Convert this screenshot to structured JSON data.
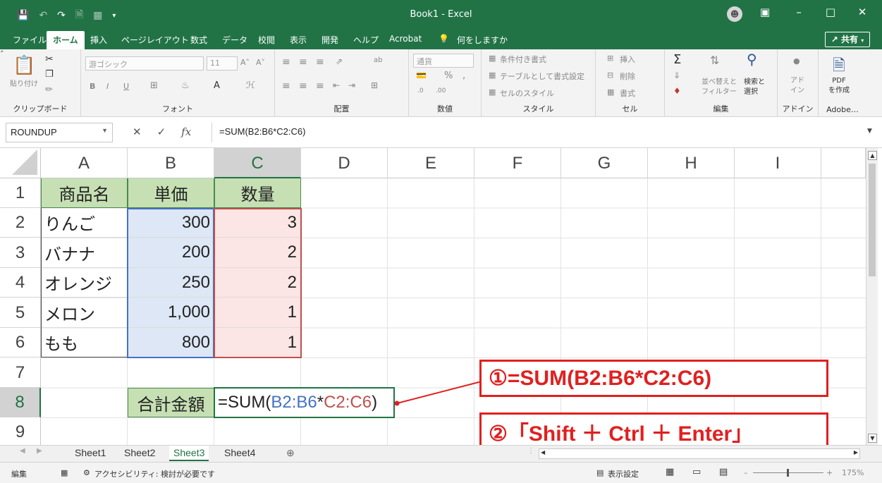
{
  "window": {
    "title": "Book1  -  Excel"
  },
  "menu": {
    "tabs": [
      "ファイル",
      "ホーム",
      "挿入",
      "ページレイアウト",
      "数式",
      "データ",
      "校閲",
      "表示",
      "開発",
      "ヘルプ",
      "Acrobat"
    ],
    "search": "何をしますか",
    "share": "共有"
  },
  "ribbon": {
    "clipboard": {
      "label": "クリップボード",
      "paste": "貼り付け"
    },
    "font": {
      "label": "フォント",
      "name": "游ゴシック",
      "size": "11"
    },
    "alignment": {
      "label": "配置"
    },
    "number": {
      "label": "数値",
      "format": "通貨"
    },
    "styles": {
      "label": "スタイル",
      "items": [
        "条件付き書式",
        "テーブルとして書式設定",
        "セルのスタイル"
      ]
    },
    "cells": {
      "label": "セル",
      "items": [
        "挿入",
        "削除",
        "書式"
      ]
    },
    "editing": {
      "label": "編集",
      "sort": "並べ替えと\nフィルター",
      "find": "検索と\n選択"
    },
    "addins": {
      "label": "アドイン",
      "item": "アド\nイン"
    },
    "adobe": {
      "label": "Adobe…",
      "item": "PDF\nを作成"
    }
  },
  "formula_bar": {
    "name_box": "ROUNDUP",
    "formula": "=SUM(B2:B6*C2:C6)"
  },
  "columns": [
    "A",
    "B",
    "C",
    "D",
    "E",
    "F",
    "G",
    "H",
    "I"
  ],
  "rows": [
    "1",
    "2",
    "3",
    "4",
    "5",
    "6",
    "7",
    "8",
    "9"
  ],
  "table": {
    "headers": [
      "商品名",
      "単価",
      "数量"
    ],
    "rows": [
      [
        "りんご",
        "300",
        "3"
      ],
      [
        "バナナ",
        "200",
        "2"
      ],
      [
        "オレンジ",
        "250",
        "2"
      ],
      [
        "メロン",
        "1,000",
        "1"
      ],
      [
        "もも",
        "800",
        "1"
      ]
    ],
    "total_label": "合計金額",
    "total_formula_parts": [
      "=SUM(",
      "B2:B6",
      "*",
      "C2:C6",
      ")"
    ]
  },
  "callouts": {
    "step1": "①=SUM(B2:B6*C2:C6)",
    "step2": "②「Shift ＋ Ctrl ＋ Enter」"
  },
  "sheets": [
    "Sheet1",
    "Sheet2",
    "Sheet3",
    "Sheet4"
  ],
  "active_sheet": "Sheet3",
  "status": {
    "mode": "編集",
    "accessibility": "アクセシビリティ: 検討が必要です",
    "display_settings": "表示設定",
    "zoom": "175%"
  },
  "colors": {
    "excel_green": "#217346",
    "header_fill": "#c6e0b4",
    "blue_ref": "#4472c4",
    "red_ref": "#c0504d",
    "callout_red": "#e02020"
  }
}
